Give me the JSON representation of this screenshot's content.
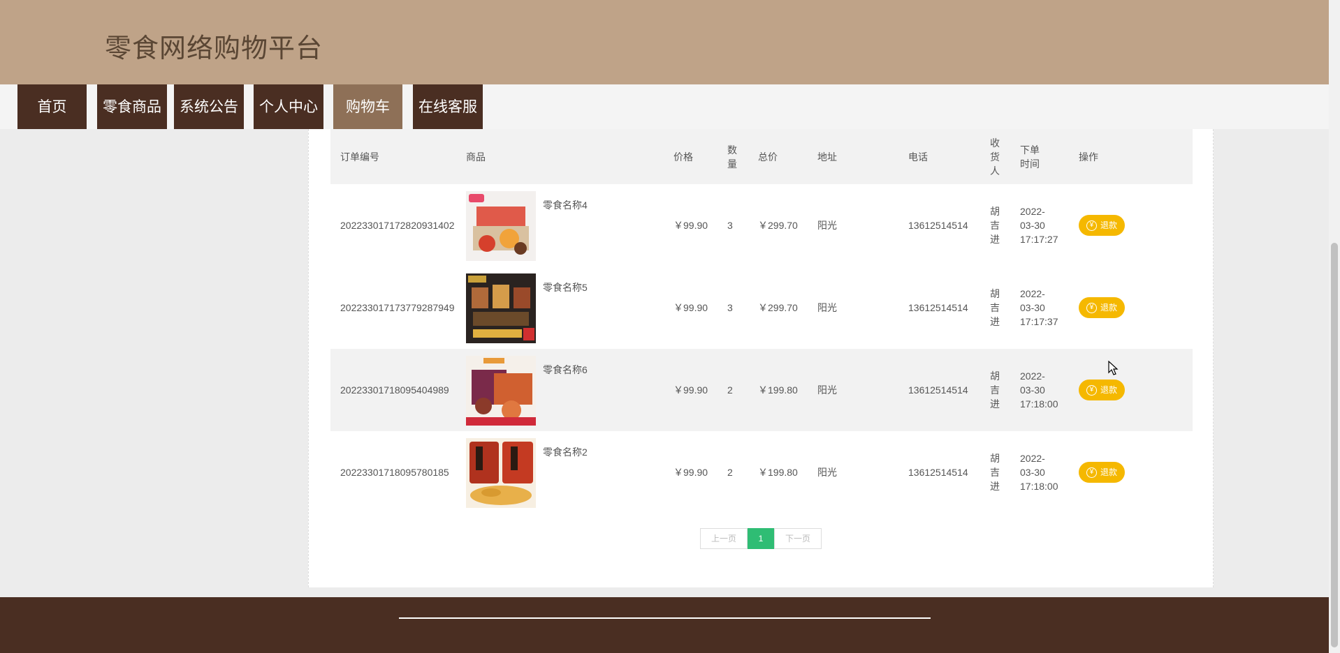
{
  "site": {
    "title": "零食网络购物平台"
  },
  "nav": [
    {
      "label": "首页"
    },
    {
      "label": "零食商品"
    },
    {
      "label": "系统公告"
    },
    {
      "label": "个人中心"
    },
    {
      "label": "购物车",
      "active": true
    },
    {
      "label": "在线客服"
    }
  ],
  "table": {
    "headers": {
      "order_no": "订单编号",
      "product": "商品",
      "price": "价格",
      "qty": "数量",
      "total": "总价",
      "address": "地址",
      "phone": "电话",
      "receiver": "收货人",
      "order_time": "下单时间",
      "action": "操作"
    },
    "rows": [
      {
        "order_no": "20223301717282093140​2",
        "product": "零食名称4",
        "price": "￥99.90",
        "qty": "3",
        "total": "￥299.70",
        "address": "阳光",
        "phone": "13612514514",
        "receiver": "胡吉进",
        "order_time": "2022-03-30 17:17:27",
        "action": "退款"
      },
      {
        "order_no": "20223301717377928794​9",
        "product": "零食名称5",
        "price": "￥99.90",
        "qty": "3",
        "total": "￥299.70",
        "address": "阳光",
        "phone": "13612514514",
        "receiver": "胡吉进",
        "order_time": "2022-03-30 17:17:37",
        "action": "退款"
      },
      {
        "order_no": "20223301718095404989",
        "product": "零食名称6",
        "price": "￥99.90",
        "qty": "2",
        "total": "￥199.80",
        "address": "阳光",
        "phone": "13612514514",
        "receiver": "胡吉进",
        "order_time": "2022-03-30 17:18:00",
        "action": "退款"
      },
      {
        "order_no": "20223301718095780185",
        "product": "零食名称2",
        "price": "￥99.90",
        "qty": "2",
        "total": "￥199.80",
        "address": "阳光",
        "phone": "13612514514",
        "receiver": "胡吉进",
        "order_time": "2022-03-30 17:18:00",
        "action": "退款"
      }
    ]
  },
  "pagination": {
    "prev": "上一页",
    "current": "1",
    "next": "下一页"
  },
  "colors": {
    "header_bg": "#bfa388",
    "nav_bg": "#4a2e22",
    "nav_active": "#8e7057",
    "refund_btn": "#f5b800",
    "page_active": "#2fbd74"
  }
}
